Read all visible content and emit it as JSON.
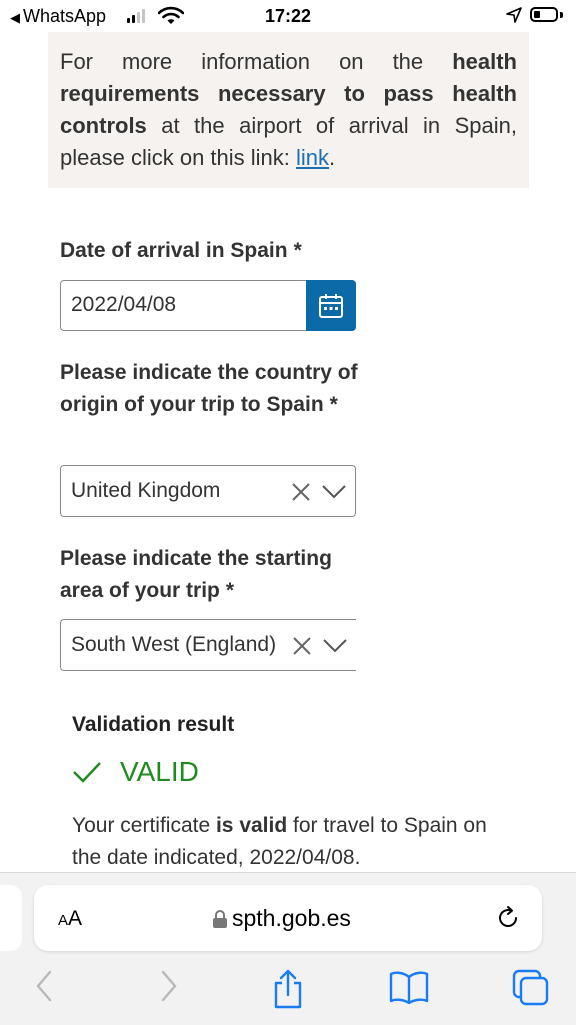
{
  "status_bar": {
    "back_app": "WhatsApp",
    "time": "17:22"
  },
  "info": {
    "part1": "For more information on the ",
    "bold": "health requirements necessary to pass health controls",
    "part2": " at the airport of arrival in Spain, please click on this link: ",
    "link": "link",
    "end": "."
  },
  "form": {
    "arrival_label": "Date of arrival in Spain",
    "required_mark": "*",
    "arrival_value": "2022/04/08",
    "origin_label": "Please indicate the country of origin of your trip to Spain",
    "origin_value": "United Kingdom",
    "area_label": "Please indicate the starting area of your trip",
    "area_value": "South West (England)"
  },
  "validation": {
    "title": "Validation result",
    "status": "VALID",
    "msg1": "Your certificate ",
    "msg_bold": "is valid",
    "msg2": " for travel to Spain on the date indicated, 2022/04/08."
  },
  "browser": {
    "text_size_small": "A",
    "text_size_large": "A",
    "url": "spth.gob.es"
  },
  "colors": {
    "accent": "#0d6aa8",
    "link": "#1a6fb5",
    "valid": "#1f8a1f",
    "info_bg": "#f5f2ef"
  },
  "icons": [
    "back-arrow-icon",
    "signal-icon",
    "wifi-icon",
    "location-icon",
    "battery-icon",
    "calendar-icon",
    "clear-icon",
    "chevron-down-icon",
    "check-icon",
    "lock-icon",
    "reload-icon",
    "back-nav-icon",
    "forward-nav-icon",
    "share-icon",
    "bookmarks-icon",
    "tabs-icon"
  ]
}
